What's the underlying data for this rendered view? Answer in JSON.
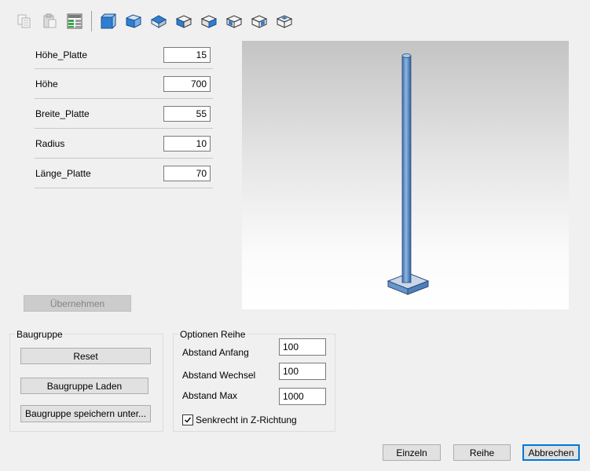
{
  "toolbar": {
    "buttons": [
      {
        "icon": "copy-icon",
        "enabled": false
      },
      {
        "icon": "paste-icon",
        "enabled": false
      },
      {
        "icon": "table-icon",
        "enabled": true
      },
      {
        "icon": "view-front-icon",
        "enabled": true
      },
      {
        "icon": "view-right-icon",
        "enabled": true
      },
      {
        "icon": "view-top-icon",
        "enabled": true
      },
      {
        "icon": "view-iso-1-icon",
        "enabled": true
      },
      {
        "icon": "view-iso-2-icon",
        "enabled": true
      },
      {
        "icon": "view-iso-3-icon",
        "enabled": true
      },
      {
        "icon": "view-iso-4-icon",
        "enabled": true
      },
      {
        "icon": "view-iso-5-icon",
        "enabled": true
      }
    ]
  },
  "params": [
    {
      "label": "Höhe_Platte",
      "value": "15"
    },
    {
      "label": "Höhe",
      "value": "700"
    },
    {
      "label": "Breite_Platte",
      "value": "55"
    },
    {
      "label": "Radius",
      "value": "10"
    },
    {
      "label": "Länge_Platte",
      "value": "70"
    }
  ],
  "apply_button": "Übernehmen",
  "baugruppe": {
    "title": "Baugruppe",
    "reset": "Reset",
    "load": "Baugruppe Laden",
    "save_as": "Baugruppe speichern unter..."
  },
  "optionen": {
    "title": "Optionen Reihe",
    "abstand_anfang_label": "Abstand Anfang",
    "abstand_anfang_value": "100",
    "abstand_wechsel_label": "Abstand Wechsel",
    "abstand_wechsel_value": "100",
    "abstand_max_label": "Abstand Max",
    "abstand_max_value": "1000",
    "senkrecht_label": "Senkrecht in Z-Richtung",
    "senkrecht_checked": true
  },
  "footer": {
    "einzeln": "Einzeln",
    "reihe": "Reihe",
    "abbrechen": "Abbrechen"
  },
  "colors": {
    "accent": "#0078d7",
    "model_blue": "#5b8fc8",
    "icon_blue": "#2f7fd0"
  }
}
